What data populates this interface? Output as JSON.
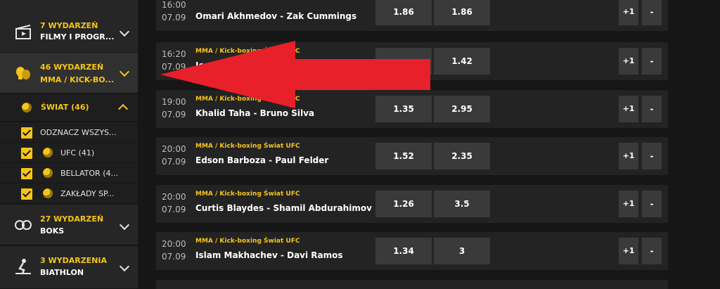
{
  "sidebar": {
    "categories": [
      {
        "count": "7 WYDARZEŃ",
        "name": "FILMY I PROGR...",
        "icon": "film-icon"
      },
      {
        "count": "46 WYDARZEŃ",
        "name": "MMA / KICK-BO...",
        "icon": "boxing-gloves-icon"
      },
      {
        "count": "27 WYDARZEŃ",
        "name": "BOKS",
        "icon": "boxing-icon"
      },
      {
        "count": "3 WYDARZENIA",
        "name": "BIATHLON",
        "icon": "biathlon-icon"
      }
    ],
    "region": {
      "label": "ŚWIAT (46)",
      "icon": "globe-icon"
    },
    "checks": [
      {
        "label": "ODZNACZ WSZYS..."
      },
      {
        "label": "UFC (41)"
      },
      {
        "label": "BELLATOR (4..."
      },
      {
        "label": "ZAKŁADY SP..."
      }
    ]
  },
  "events": [
    {
      "time": "16:00",
      "date": "07.09",
      "league": "",
      "name": "Omari Akhmedov - Zak Cummings",
      "odd1": "1.86",
      "odd2": "1.86",
      "more": "+1",
      "minus": "-"
    },
    {
      "time": "16:20",
      "date": "07.09",
      "league": "MMA / Kick-boxing Świat UFC",
      "name": "Ion",
      "odd1": "",
      "odd2": "1.42",
      "more": "+1",
      "minus": "-"
    },
    {
      "time": "19:00",
      "date": "07.09",
      "league": "MMA / Kick-boxing Świat UFC",
      "name": "Khalid Taha - Bruno Silva",
      "odd1": "1.35",
      "odd2": "2.95",
      "more": "+1",
      "minus": "-"
    },
    {
      "time": "20:00",
      "date": "07.09",
      "league": "MMA / Kick-boxing Świat UFC",
      "name": "Edson Barboza - Paul Felder",
      "odd1": "1.52",
      "odd2": "2.35",
      "more": "+1",
      "minus": "-"
    },
    {
      "time": "20:00",
      "date": "07.09",
      "league": "MMA / Kick-boxing Świat UFC",
      "name": "Curtis Blaydes - Shamil Abdurahimov",
      "odd1": "1.26",
      "odd2": "3.5",
      "more": "+1",
      "minus": "-"
    },
    {
      "time": "20:00",
      "date": "07.09",
      "league": "MMA / Kick-boxing Świat UFC",
      "name": "Islam Makhachev - Davi Ramos",
      "odd1": "1.34",
      "odd2": "3",
      "more": "+1",
      "minus": "-"
    }
  ],
  "colors": {
    "accent": "#f5c518",
    "arrow": "#e8202a",
    "card": "#232323",
    "odd_bg": "#3a3a3a"
  }
}
